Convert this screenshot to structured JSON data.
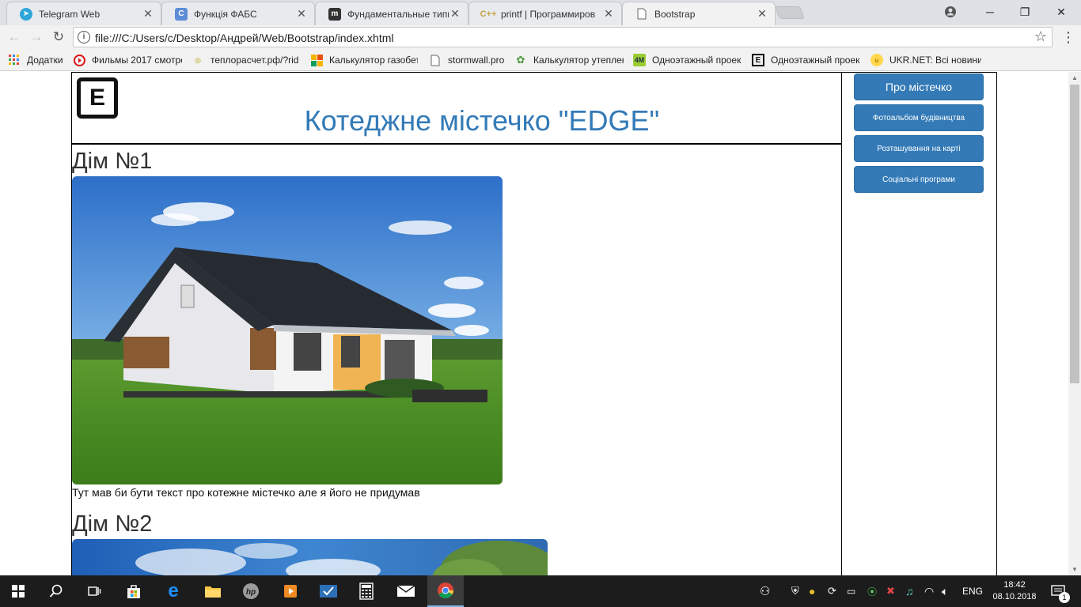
{
  "browser": {
    "tabs": [
      {
        "title": "Telegram Web",
        "icon": "telegram-icon",
        "color": "#2ea6da"
      },
      {
        "title": "Функція ФАБС",
        "icon": "cpp-icon",
        "color": "#5c8dd6"
      },
      {
        "title": "Фундаментальные типы",
        "icon": "metanit-icon",
        "color": "#333333"
      },
      {
        "title": "printf | Программиров",
        "icon": "cpp-ref-icon",
        "color": "#c9a24a"
      },
      {
        "title": "Bootstrap",
        "icon": "document-icon",
        "color": "#777777"
      }
    ],
    "url": "file:///C:/Users/c/Desktop/Андрей/Web/Bootstrap/index.xhtml",
    "bookmarks": [
      {
        "label": "Додатки",
        "icon": "apps-icon"
      },
      {
        "label": "Фильмы 2017 смотре",
        "icon": "play-icon"
      },
      {
        "label": "теплорасчет.рф/?rid",
        "icon": "spiral-icon"
      },
      {
        "label": "Калькулятор газобет",
        "icon": "blocks-icon"
      },
      {
        "label": "stormwall.pro",
        "icon": "document-icon"
      },
      {
        "label": "Калькулятор утеплен",
        "icon": "leaf-icon"
      },
      {
        "label": "Одноэтажный проек",
        "icon": "4m-icon"
      },
      {
        "label": "Одноэтажный проек",
        "icon": "e-icon"
      },
      {
        "label": "UKR.NET: Всі новини",
        "icon": "ukrnet-icon"
      }
    ]
  },
  "page": {
    "logo_letter": "E",
    "title": "Котеджне містечко \"EDGE\"",
    "houses": [
      {
        "heading": "Дім №1",
        "text": "Тут мав би бути текст про котежне містечко але я його не придумав"
      },
      {
        "heading": "Дім №2",
        "text": ""
      }
    ],
    "sidebar": [
      "Про містечко",
      "Фотоальбом будівництва",
      "Розташування на карті",
      "Соціальні програми"
    ]
  },
  "taskbar": {
    "language": "ENG",
    "time": "18:42",
    "date": "08.10.2018",
    "notification_count": "1"
  }
}
